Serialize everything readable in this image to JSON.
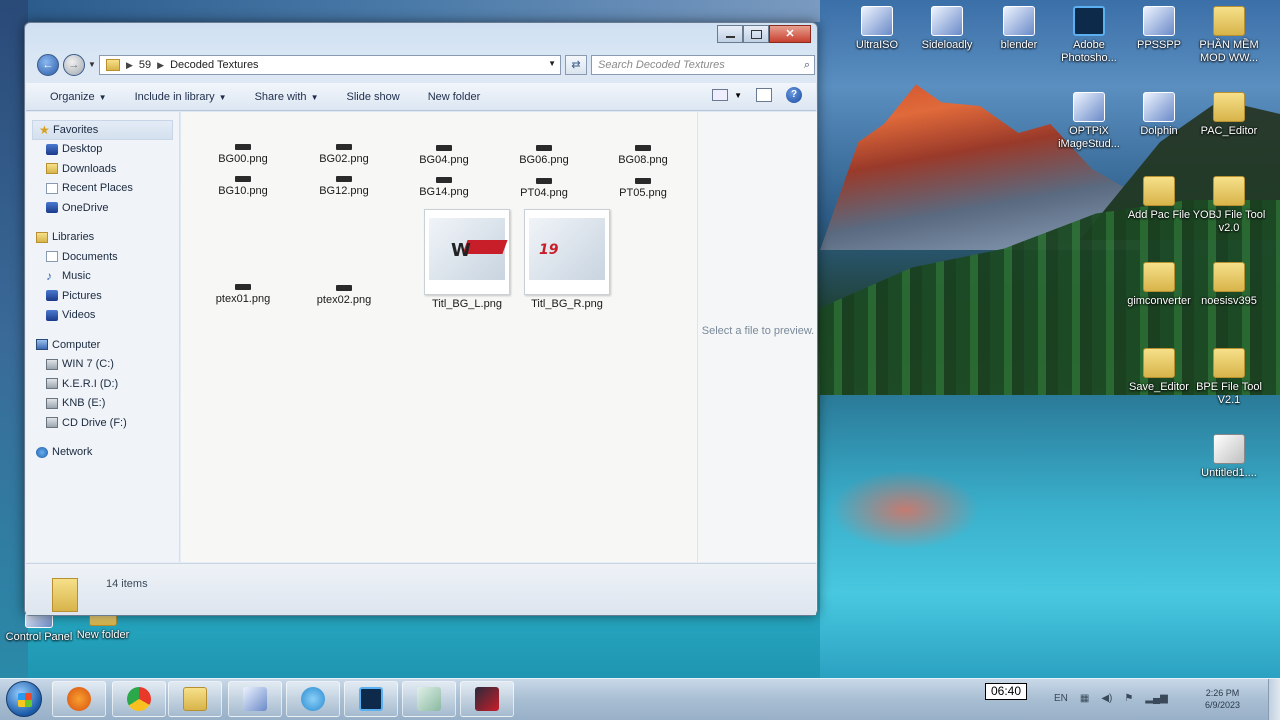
{
  "desktop": {
    "icons_right": [
      {
        "label": "UltraISO",
        "icon": "ultraiso-icon",
        "kind": "app"
      },
      {
        "label": "Sideloadly",
        "icon": "sideloadly-icon",
        "kind": "app"
      },
      {
        "label": "blender",
        "icon": "blender-icon",
        "kind": "app"
      },
      {
        "label": "Adobe Photosho...",
        "icon": "photoshop-icon",
        "kind": "ps"
      },
      {
        "label": "PPSSPP",
        "icon": "ppsspp-icon",
        "kind": "app"
      },
      {
        "label": "PHẦN MỀM MOD WW...",
        "icon": "folder-icon",
        "kind": "folder"
      },
      {
        "label": "OPTPiX iMageStud...",
        "icon": "optpix-icon",
        "kind": "app"
      },
      {
        "label": "Dolphin",
        "icon": "dolphin-icon",
        "kind": "app"
      },
      {
        "label": "PAC_Editor",
        "icon": "folder-icon",
        "kind": "folder"
      },
      {
        "label": "Add Pac File",
        "icon": "folder-icon",
        "kind": "folder"
      },
      {
        "label": "YOBJ File Tool v2.0",
        "icon": "folder-icon",
        "kind": "folder"
      },
      {
        "label": "gimconverter",
        "icon": "folder-icon",
        "kind": "folder"
      },
      {
        "label": "noesisv395",
        "icon": "folder-icon",
        "kind": "folder"
      },
      {
        "label": "Save_Editor",
        "icon": "folder-icon",
        "kind": "folder"
      },
      {
        "label": "BPE File Tool V2.1",
        "icon": "folder-icon",
        "kind": "folder"
      },
      {
        "label": "Untitled1....",
        "icon": "document-icon",
        "kind": "tool"
      }
    ],
    "icons_bottom": [
      {
        "label": "Control Panel",
        "icon": "control-panel-icon"
      },
      {
        "label": "New folder",
        "icon": "folder-icon"
      }
    ]
  },
  "explorer": {
    "breadcrumb": [
      "59",
      "Decoded Textures"
    ],
    "search_placeholder": "Search Decoded Textures",
    "toolbar": {
      "organize": "Organize",
      "include": "Include in library",
      "share": "Share with",
      "slideshow": "Slide show",
      "newfolder": "New folder"
    },
    "nav": {
      "favorites": "Favorites",
      "desktop": "Desktop",
      "downloads": "Downloads",
      "recent": "Recent Places",
      "onedrive": "OneDrive",
      "libraries": "Libraries",
      "documents": "Documents",
      "music": "Music",
      "pictures": "Pictures",
      "videos": "Videos",
      "computer": "Computer",
      "drive_c": "WIN 7 (C:)",
      "drive_d": "K.E.R.I (D:)",
      "drive_e": "KNB (E:)",
      "drive_f": "CD Drive (F:)",
      "network": "Network"
    },
    "files": [
      "BG00.png",
      "BG02.png",
      "BG04.png",
      "BG06.png",
      "BG08.png",
      "BG10.png",
      "BG12.png",
      "BG14.png",
      "PT04.png",
      "PT05.png",
      "ptex01.png",
      "ptex02.png"
    ],
    "thumbs": [
      {
        "label": "Titl_BG_L.png",
        "logo": "W"
      },
      {
        "label": "Titl_BG_R.png",
        "logo": "19"
      }
    ],
    "preview_msg": "Select a file to preview.",
    "item_count": "14 items"
  },
  "taskbar": {
    "time": "2:26 PM",
    "date": "6/9/2023",
    "lang": "EN",
    "tooltip": "06:40"
  }
}
